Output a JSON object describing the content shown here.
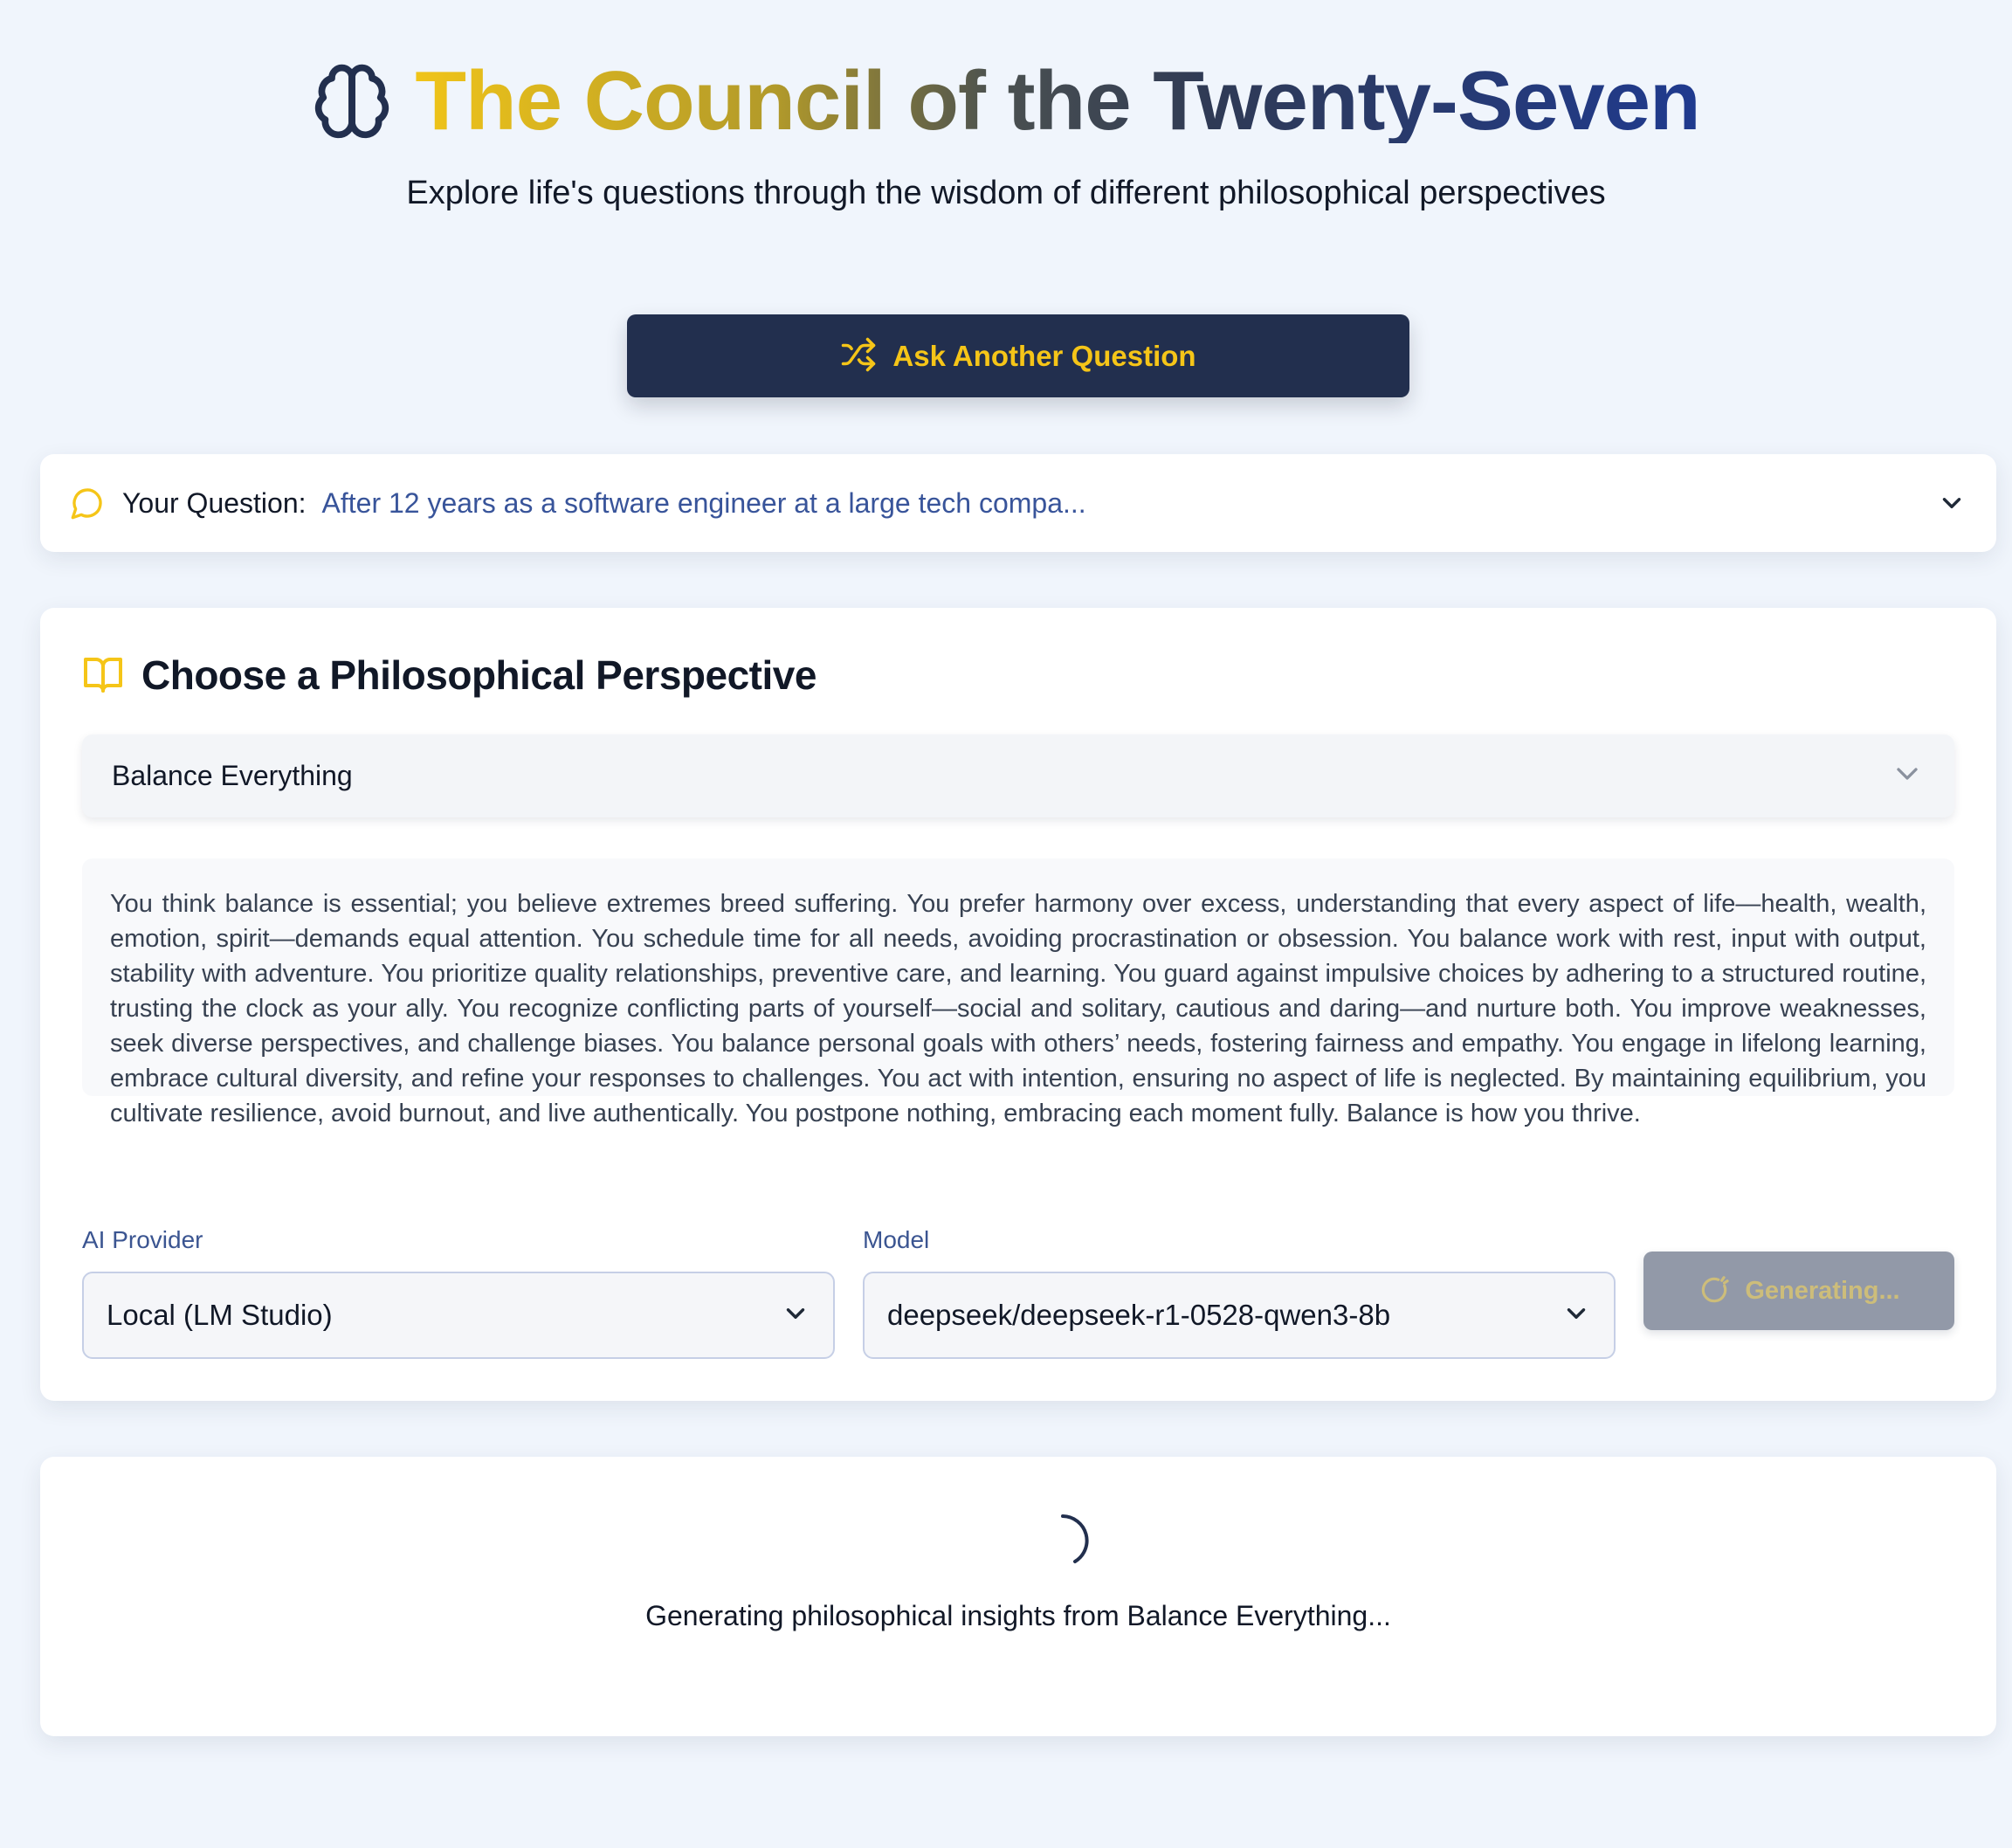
{
  "header": {
    "title": "The Council of the Twenty-Seven",
    "subtitle": "Explore life's questions through the wisdom of different philosophical perspectives",
    "icon": "brain-icon"
  },
  "ask_button": {
    "label": "Ask Another Question",
    "icon": "shuffle-icon"
  },
  "question": {
    "label": "Your Question:",
    "text": "After 12 years as a software engineer at a large tech compa...",
    "icon": "message-circle-icon"
  },
  "perspective": {
    "heading": "Choose a Philosophical Perspective",
    "icon": "book-open-icon",
    "selected": "Balance Everything",
    "description": "You think balance is essential; you believe extremes breed suffering. You prefer harmony over excess, understanding that every aspect of life—health, wealth, emotion, spirit—demands equal attention. You schedule time for all needs, avoiding procrastination or obsession. You balance work with rest, input with output, stability with adventure. You prioritize quality relationships, preventive care, and learning. You guard against impulsive choices by adhering to a structured routine, trusting the clock as your ally. You recognize conflicting parts of yourself—social and solitary, cautious and daring—and nurture both. You improve weaknesses, seek diverse perspectives, and challenge biases. You balance personal goals with others’ needs, fostering fairness and empathy. You engage in lifelong learning, embrace cultural diversity, and refine your responses to challenges. You act with intention, ensuring no aspect of life is neglected. By maintaining equilibrium, you cultivate resilience, avoid burnout, and live authentically. You postpone nothing, embracing each moment fully. Balance is how you thrive."
  },
  "provider": {
    "label": "AI Provider",
    "value": "Local (LM Studio)"
  },
  "model": {
    "label": "Model",
    "value": "deepseek/deepseek-r1-0528-qwen3-8b"
  },
  "generate_button": {
    "label": "Generating...",
    "icon": "loader-icon"
  },
  "loading": {
    "text": "Generating philosophical insights from Balance Everything..."
  },
  "colors": {
    "background": "#f0f5fc",
    "navy": "#222f4e",
    "gold": "#f5c518",
    "accent_blue": "#38549a"
  }
}
